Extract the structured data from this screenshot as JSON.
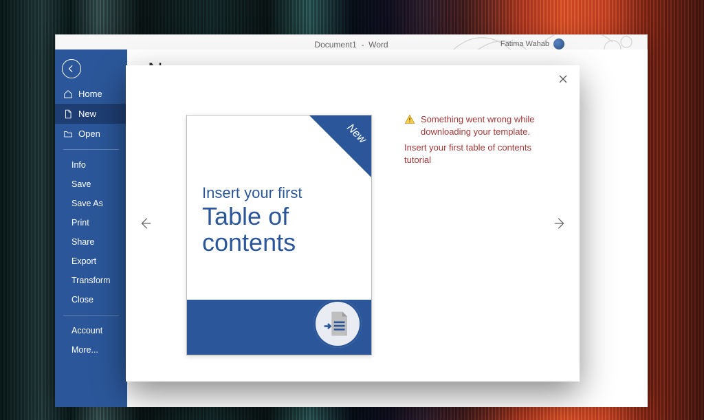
{
  "titlebar": {
    "doc": "Document1",
    "app": "Word",
    "user": "Fatima Wahab"
  },
  "backstage": {
    "title": "New",
    "items_primary": [
      {
        "id": "home",
        "label": "Home",
        "icon": "home"
      },
      {
        "id": "new",
        "label": "New",
        "icon": "document",
        "selected": true
      },
      {
        "id": "open",
        "label": "Open",
        "icon": "folder"
      }
    ],
    "items_secondary": [
      {
        "id": "info",
        "label": "Info"
      },
      {
        "id": "save",
        "label": "Save"
      },
      {
        "id": "saveas",
        "label": "Save As"
      },
      {
        "id": "print",
        "label": "Print"
      },
      {
        "id": "share",
        "label": "Share"
      },
      {
        "id": "export",
        "label": "Export"
      },
      {
        "id": "transform",
        "label": "Transform"
      },
      {
        "id": "close",
        "label": "Close"
      }
    ],
    "items_footer": [
      {
        "id": "account",
        "label": "Account"
      },
      {
        "id": "more",
        "label": "More..."
      }
    ]
  },
  "dialog": {
    "ribbon": "New",
    "thumb_line1": "Insert your first",
    "thumb_line2": "Table of contents",
    "error_line1": "Something went wrong while downloading your template.",
    "error_line2": "Insert your first table of contents tutorial",
    "colors": {
      "accent": "#2b579a",
      "error": "#a33836"
    }
  }
}
